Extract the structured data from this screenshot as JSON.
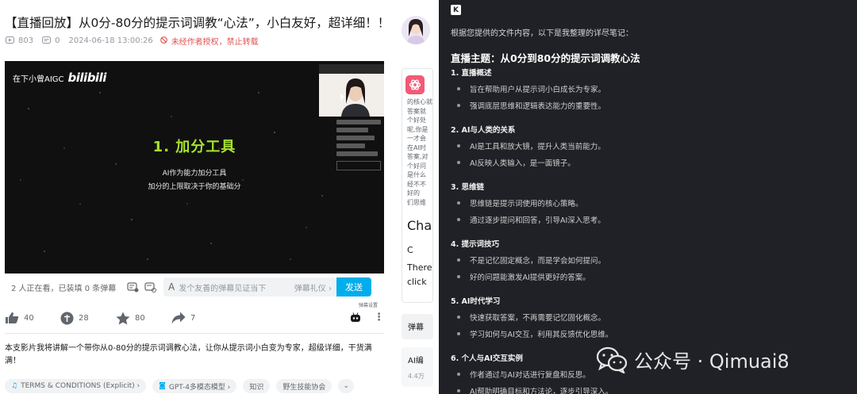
{
  "video": {
    "title": "【直播回放】从0分-80分的提示词调教“心法”，小白友好，超详细！！",
    "views": "803",
    "danmaku_count": "0",
    "datetime": "2024-06-18 13:00:26",
    "rights": "未经作者授权，禁止转载"
  },
  "player": {
    "brand_prefix": "在下小曾AIGC",
    "brand_logo": "bilibili",
    "slide_title": "1.  加分工具",
    "slide_lines": [
      "AI作为能力加分工具",
      "加分的上限取决于你的基础分"
    ]
  },
  "danmaku_bar": {
    "watching": "2 人正在看，已装填 0 条弹幕",
    "placeholder": "发个友善的弹幕见证当下",
    "etiquette": "弹幕礼仪 ›",
    "send": "发送",
    "mini_label": "弹幕设置"
  },
  "actions": {
    "like": "40",
    "coin": "28",
    "fav": "80",
    "share": "7"
  },
  "description": "本支影片我将讲解一个带你从0-80分的提示词调教心法，让你从提示词小白变为专家，超级详细，干货满满！",
  "tags": [
    "TERMS & CONDITIONS (Explicit) ›",
    "GPT-4多模态模型 ›",
    "知识",
    "野生技能协会"
  ],
  "sidebar": {
    "text_lines": [
      "的核心就",
      "答案就",
      "个好处",
      "呢,你是",
      "一才会",
      "在AI时",
      "答案,对",
      "个好问",
      "是什么",
      "经不不",
      "好的",
      "们思维"
    ],
    "cha": "Cha",
    "c_letter": "C",
    "there": "There",
    "click": "click",
    "btn1": "弹幕",
    "btn2": "AI编",
    "btn2_sub": "4.4万"
  },
  "notes": {
    "intro": "根据您提供的文件内容，以下是我整理的详尽笔记：",
    "heading": "直播主题：从0分到80分的提示词调教心法",
    "sections": [
      {
        "title": "1. 直播概述",
        "bullets": [
          "旨在帮助用户从提示词小白成长为专家。",
          "强调底层思维和逻辑表达能力的重要性。"
        ]
      },
      {
        "title": "2. AI与人类的关系",
        "bullets": [
          "AI是工具和放大镜，提升人类当前能力。",
          "AI反映人类输入，是一面镜子。"
        ]
      },
      {
        "title": "3. 思维链",
        "bullets": [
          "思维链是提示词使用的核心策略。",
          "通过逐步提问和回答，引导AI深入思考。"
        ]
      },
      {
        "title": "4. 提示词技巧",
        "bullets": [
          "不是记忆固定概念，而是学会如何提问。",
          "好的问题能激发AI提供更好的答案。"
        ]
      },
      {
        "title": "5. AI时代学习",
        "bullets": [
          "快速获取答案，不再需要记忆固化概念。",
          "学习如何与AI交互，利用其反馈优化思维。"
        ]
      },
      {
        "title": "6. 个人与AI交互实例",
        "bullets": [
          "作者通过与AI对话进行复盘和反思。",
          "AI帮助明确目标和方法论，逐步引导深入。"
        ]
      }
    ]
  },
  "watermark": "公众号 · Qimuai8",
  "colors": {
    "accent_blue": "#00aeec",
    "slide_green": "#a7e22e",
    "panel_bg": "#1f2126",
    "warn_red": "#e05252"
  }
}
